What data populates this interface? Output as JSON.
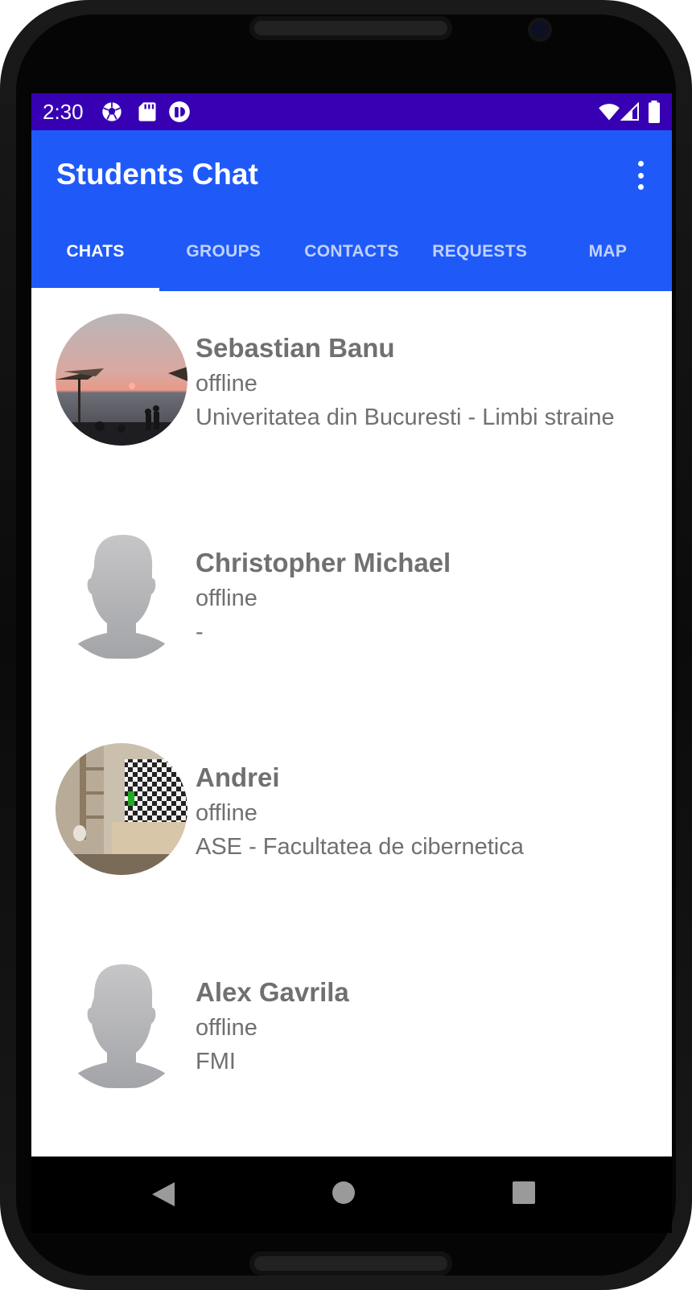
{
  "status_bar": {
    "time": "2:30",
    "left_icons": [
      "soccer-ball-icon",
      "sd-card-icon",
      "app-notification-icon"
    ],
    "right_icons": [
      "wifi-icon",
      "cell-signal-icon",
      "battery-icon"
    ]
  },
  "app_bar": {
    "title": "Students Chat",
    "overflow_icon": "more-vert-icon"
  },
  "tabs": [
    {
      "label": "CHATS",
      "active": true
    },
    {
      "label": "GROUPS",
      "active": false
    },
    {
      "label": "CONTACTS",
      "active": false
    },
    {
      "label": "REQUESTS",
      "active": false
    },
    {
      "label": "MAP",
      "active": false
    }
  ],
  "chats": [
    {
      "name": "Sebastian Banu",
      "status": "offline",
      "university": "Univeritatea din Bucuresti - Limbi straine",
      "avatar": "photo-sunset-beach"
    },
    {
      "name": "Christopher Michael",
      "status": "offline",
      "university": "-",
      "avatar": "default-person-silhouette"
    },
    {
      "name": "Andrei",
      "status": "offline",
      "university": "ASE - Facultatea de cibernetica",
      "avatar": "photo-living-room-tv"
    },
    {
      "name": "Alex Gavrila",
      "status": "offline",
      "university": "FMI",
      "avatar": "default-person-silhouette"
    }
  ],
  "nav_bar": {
    "icons": [
      "back-icon",
      "home-icon",
      "recents-icon"
    ]
  },
  "colors": {
    "status_bar": "#3700b3",
    "app_bar": "#1f5af9",
    "text_gray": "#707070"
  }
}
